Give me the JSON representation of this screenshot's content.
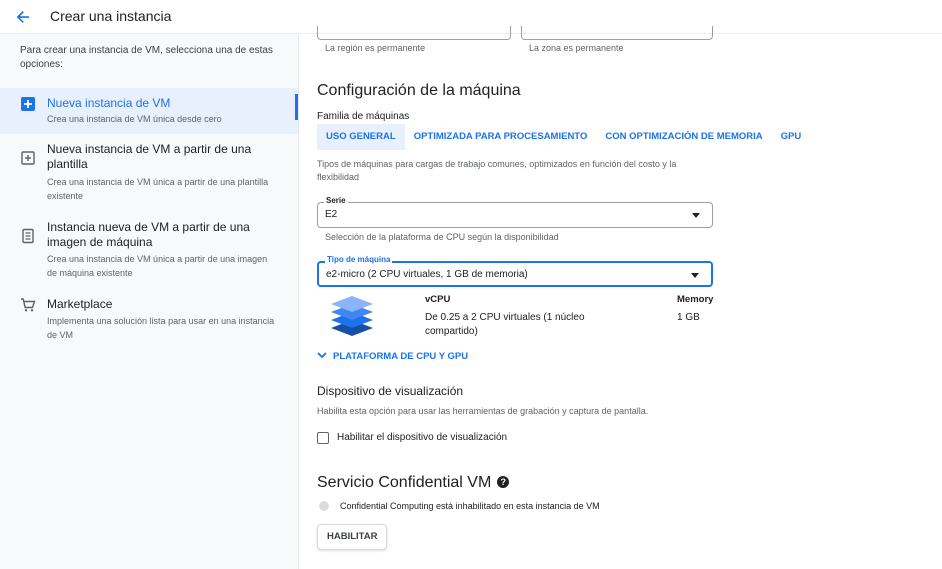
{
  "header": {
    "title": "Crear una instancia",
    "back_icon": "arrow-left-icon"
  },
  "sidebar": {
    "intro": "Para crear una instancia de VM, selecciona una de estas opciones:",
    "options": [
      {
        "title": "Nueva instancia de VM",
        "desc": "Crea una instancia de VM única desde cero",
        "icon": "add-box-icon",
        "selected": true
      },
      {
        "title": "Nueva instancia de VM a partir de una plantilla",
        "desc": "Crea una instancia de VM única a partir de una plantilla existente",
        "icon": "template-icon",
        "selected": false
      },
      {
        "title": "Instancia nueva de VM a partir de una imagen de máquina",
        "desc": "Crea una instancia de VM única a partir de una imagen de máquina existente",
        "icon": "machine-image-icon",
        "selected": false
      },
      {
        "title": "Marketplace",
        "desc": "Implementa una solución lista para usar en una instancia de VM",
        "icon": "cart-icon",
        "selected": false
      }
    ]
  },
  "main": {
    "region_helper": "La región es permanente",
    "zone_helper": "La zona es permanente",
    "machine_config_title": "Configuración de la máquina",
    "family_label": "Familia de máquinas",
    "family_tabs": [
      {
        "label": "USO GENERAL",
        "active": true
      },
      {
        "label": "OPTIMIZADA PARA PROCESAMIENTO",
        "active": false
      },
      {
        "label": "CON OPTIMIZACIÓN DE MEMORIA",
        "active": false
      },
      {
        "label": "GPU",
        "active": false
      }
    ],
    "family_desc": "Tipos de máquinas para cargas de trabajo comunes, optimizados en función del costo y la flexibilidad",
    "series": {
      "label": "Serie",
      "value": "E2",
      "helper": "Selección de la plataforma de CPU según la disponibilidad"
    },
    "machine_type": {
      "label": "Tipo de máquina",
      "value": "e2-micro (2 CPU virtuales, 1 GB de memoria)"
    },
    "specs": {
      "vcpu_header": "vCPU",
      "memory_header": "Memory",
      "vcpu_value": "De 0.25 a 2 CPU virtuales (1 núcleo compartido)",
      "memory_value": "1 GB"
    },
    "cpu_platform_link": "PLATAFORMA DE CPU Y GPU",
    "display": {
      "title": "Dispositivo de visualización",
      "desc": "Habilita esta opción para usar las herramientas de grabación y captura de pantalla.",
      "checkbox_label": "Habilitar el dispositivo de visualización",
      "checked": false
    },
    "confidential": {
      "title": "Servicio Confidential VM",
      "status": "Confidential Computing está inhabilitado en esta instancia de VM",
      "button": "HABILITAR"
    }
  },
  "colors": {
    "accent": "#1a73e8",
    "selected_bg": "#e8f0fe",
    "sidebar_bg": "#f8f9fa"
  }
}
